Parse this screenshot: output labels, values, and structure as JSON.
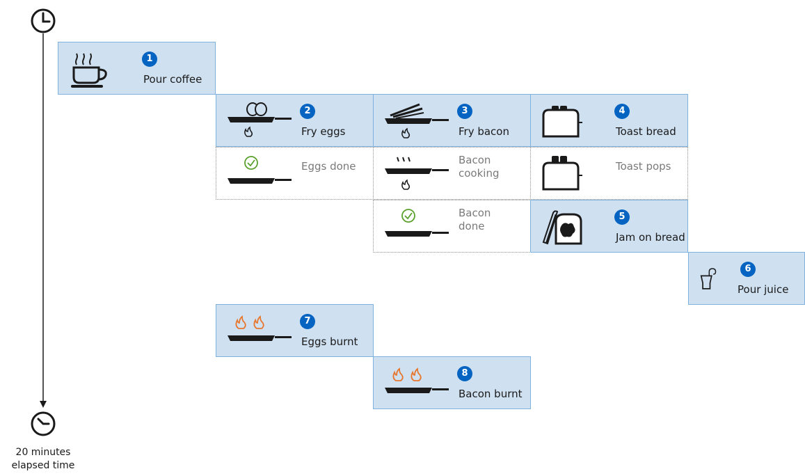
{
  "timeline": {
    "end_label_line1": "20 minutes",
    "end_label_line2": "elapsed time"
  },
  "steps": [
    {
      "id": "pour-coffee",
      "number": "1",
      "label": "Pour coffee",
      "icon": "coffee-cup-icon"
    },
    {
      "id": "fry-eggs",
      "number": "2",
      "label": "Fry eggs",
      "icon": "frying-eggs-icon"
    },
    {
      "id": "fry-bacon",
      "number": "3",
      "label": "Fry bacon",
      "icon": "frying-bacon-icon"
    },
    {
      "id": "toast-bread",
      "number": "4",
      "label": "Toast bread",
      "icon": "toaster-icon"
    },
    {
      "id": "jam-on-bread",
      "number": "5",
      "label": "Jam on bread",
      "icon": "jam-bread-icon"
    },
    {
      "id": "pour-juice",
      "number": "6",
      "label": "Pour juice",
      "icon": "juice-glass-icon"
    },
    {
      "id": "eggs-burnt",
      "number": "7",
      "label": "Eggs burnt",
      "icon": "burnt-pan-icon"
    },
    {
      "id": "bacon-burnt",
      "number": "8",
      "label": "Bacon burnt",
      "icon": "burnt-pan-icon"
    }
  ],
  "states": [
    {
      "id": "eggs-done",
      "label": "Eggs done",
      "icon": "pan-done-icon"
    },
    {
      "id": "bacon-cooking",
      "label_line1": "Bacon",
      "label_line2": "cooking",
      "icon": "pan-cooking-icon"
    },
    {
      "id": "toast-pops",
      "label": "Toast pops",
      "icon": "toaster-icon"
    },
    {
      "id": "bacon-done",
      "label_line1": "Bacon",
      "label_line2": "done",
      "icon": "pan-done-icon"
    }
  ],
  "colors": {
    "card_fill": "#cfe0f1",
    "card_border": "#7fb1de",
    "badge": "#0563c1",
    "done_check": "#5aa02c",
    "burn_flame": "#e8772e",
    "timeline": "#1a1a1a"
  }
}
